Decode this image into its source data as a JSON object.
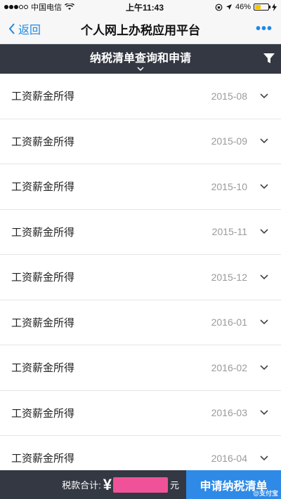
{
  "status_bar": {
    "carrier": "中国电信",
    "time": "上午11:43",
    "battery": "46%",
    "battery_level": 0.46
  },
  "nav": {
    "back_label": "返回",
    "title": "个人网上办税应用平台"
  },
  "section": {
    "title": "纳税清单查询和申请"
  },
  "items": [
    {
      "label": "工资薪金所得",
      "date": "2015-08"
    },
    {
      "label": "工资薪金所得",
      "date": "2015-09"
    },
    {
      "label": "工资薪金所得",
      "date": "2015-10"
    },
    {
      "label": "工资薪金所得",
      "date": "2015-11"
    },
    {
      "label": "工资薪金所得",
      "date": "2015-12"
    },
    {
      "label": "工资薪金所得",
      "date": "2016-01"
    },
    {
      "label": "工资薪金所得",
      "date": "2016-02"
    },
    {
      "label": "工资薪金所得",
      "date": "2016-03"
    },
    {
      "label": "工资薪金所得",
      "date": "2016-04"
    }
  ],
  "footer": {
    "total_label": "税款合计:",
    "currency": "¥",
    "unit": "元",
    "apply_label": "申请纳税清单",
    "watermark": "@支付宝"
  },
  "colors": {
    "accent": "#1e88e5",
    "header_dark": "#333842",
    "apply_button": "#2e8ae6",
    "redaction": "#f0529a"
  }
}
